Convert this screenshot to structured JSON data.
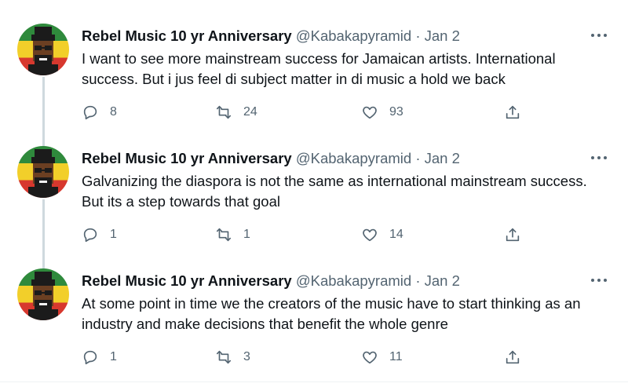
{
  "tweets": [
    {
      "name": "Rebel Music 10 yr Anniversary",
      "handle": "@Kabakapyramid",
      "dot": "·",
      "date": "Jan 2",
      "text": "I want to see more mainstream success for Jamaican artists. International success. But i jus feel di subject matter in di music a hold we back",
      "replies": "8",
      "retweets": "24",
      "likes": "93"
    },
    {
      "name": "Rebel Music 10 yr Anniversary",
      "handle": "@Kabakapyramid",
      "dot": "·",
      "date": "Jan 2",
      "text": "Galvanizing the diaspora is not the same as international mainstream success. But its a step towards that goal",
      "replies": "1",
      "retweets": "1",
      "likes": "14"
    },
    {
      "name": "Rebel Music 10 yr Anniversary",
      "handle": "@Kabakapyramid",
      "dot": "·",
      "date": "Jan 2",
      "text": "At some point in time we the creators of the music have to start thinking as an industry and make decisions that benefit the whole genre",
      "replies": "1",
      "retweets": "3",
      "likes": "11"
    }
  ],
  "icons": {
    "reply": "reply-icon",
    "retweet": "retweet-icon",
    "like": "heart-icon",
    "share": "share-icon",
    "more": "more-icon"
  },
  "colors": {
    "text_primary": "#0f1419",
    "text_secondary": "#536471",
    "thread_line": "#cfd9de",
    "avatar_green": "#2f8a3c",
    "avatar_yellow": "#f2cf2a",
    "avatar_red": "#d7382e"
  }
}
